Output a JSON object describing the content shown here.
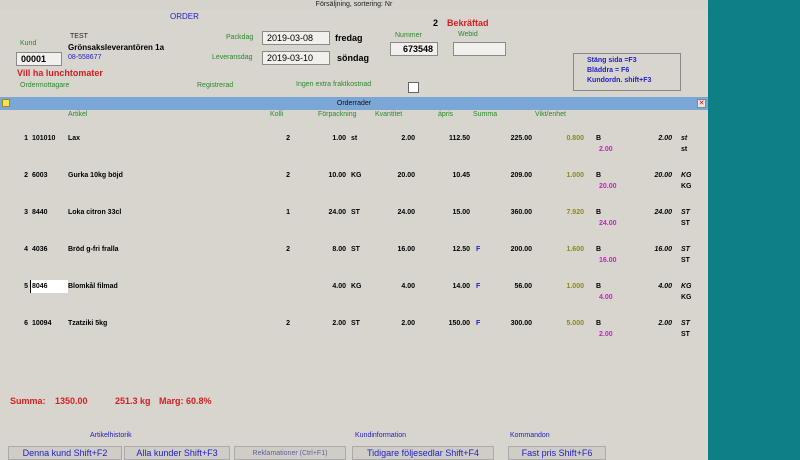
{
  "window": {
    "title": "Försäljning, sortering: Nr"
  },
  "header": {
    "order_label": "ORDER",
    "status_number": "2",
    "status_text": "Bekräftad",
    "customer_name": "TEST",
    "customer_company": "Grönsaksleverantören 1a",
    "customer_phone": "08-558677",
    "kund_label": "Kund",
    "kund_value": "00001",
    "note": "Vill ha lunchtomater",
    "packdag_label": "Packdag",
    "packdag_value": "2019-03-08",
    "packdag_day": "fredag",
    "leveransdag_label": "Leveransdag",
    "leveransdag_value": "2019-03-10",
    "leveransdag_day": "söndag",
    "nummer_label": "Nummer",
    "nummer_value": "673548",
    "webid_label": "Webid",
    "webid_value": "",
    "ordermottagare_label": "Ordermottagare",
    "registrerad_label": "Registrerad",
    "fraktkostnad_label": "Ingen extra fraktkostnad"
  },
  "shortcuts": [
    "Stäng sida =F3",
    "Bläddra = F6",
    "Kundordn. shift+F3"
  ],
  "inner_window": {
    "title": "Orderrader",
    "close_glyph": "✕"
  },
  "columns": {
    "artikel": "Artikel",
    "kolli": "Kolli",
    "forpackning": "Förpackning",
    "kvantitet": "Kvantitet",
    "apris": "ápris",
    "summa": "Summa",
    "vikt": "Vikt/enhet"
  },
  "rows": [
    {
      "nr": "1",
      "code": "101010",
      "name": "Lax",
      "kolli": "2",
      "forp": "1.00",
      "unit": "st",
      "qty": "2.00",
      "price": "112.50",
      "flag": "",
      "sum": "225.00",
      "weight": "0.800",
      "b": "B",
      "bsub": "2.00",
      "right": "2.00",
      "ru1": "st",
      "ru2": "st"
    },
    {
      "nr": "2",
      "code": "6003",
      "name": "Gurka  10kg böjd",
      "kolli": "2",
      "forp": "10.00",
      "unit": "KG",
      "qty": "20.00",
      "price": "10.45",
      "flag": "",
      "sum": "209.00",
      "weight": "1.000",
      "b": "B",
      "bsub": "20.00",
      "right": "20.00",
      "ru1": "KG",
      "ru2": "KG"
    },
    {
      "nr": "3",
      "code": "8440",
      "name": "Loka citron 33cl",
      "kolli": "1",
      "forp": "24.00",
      "unit": "ST",
      "qty": "24.00",
      "price": "15.00",
      "flag": "",
      "sum": "360.00",
      "weight": "7.920",
      "b": "B",
      "bsub": "24.00",
      "right": "24.00",
      "ru1": "ST",
      "ru2": "ST"
    },
    {
      "nr": "4",
      "code": "4036",
      "name": "Bröd g-fri fralla",
      "kolli": "2",
      "forp": "8.00",
      "unit": "ST",
      "qty": "16.00",
      "price": "12.50",
      "flag": "F",
      "sum": "200.00",
      "weight": "1.600",
      "b": "B",
      "bsub": "16.00",
      "right": "16.00",
      "ru1": "ST",
      "ru2": "ST"
    },
    {
      "nr": "5",
      "code": "8046",
      "name": "Blomkål filmad",
      "kolli": "",
      "forp": "4.00",
      "unit": "KG",
      "qty": "4.00",
      "price": "14.00",
      "flag": "F",
      "sum": "56.00",
      "weight": "1.000",
      "b": "B",
      "bsub": "4.00",
      "right": "4.00",
      "ru1": "KG",
      "ru2": "KG"
    },
    {
      "nr": "6",
      "code": "10094",
      "name": "Tzatziki 5kg",
      "kolli": "2",
      "forp": "2.00",
      "unit": "ST",
      "qty": "2.00",
      "price": "150.00",
      "flag": "F",
      "sum": "300.00",
      "weight": "5.000",
      "b": "B",
      "bsub": "2.00",
      "right": "2.00",
      "ru1": "ST",
      "ru2": "ST"
    }
  ],
  "totals": {
    "summa_label": "Summa:",
    "summa": "1350.00",
    "weight": "251.3 kg",
    "marg": "Marg:  60.8%"
  },
  "sections": {
    "artikelhistorik": "Artikelhistorik",
    "kundinformation": "Kundinformation",
    "kommandon": "Kommandon"
  },
  "buttons": {
    "denna_kund": "Denna kund Shift+F2",
    "alla_kunder": "Alla kunder Shift+F3",
    "reklamationer": "Reklamationer (Ctrl+F1)",
    "tidigare": "Tidigare följesedlar Shift+F4",
    "fast_pris": "Fast pris Shift+F6"
  }
}
